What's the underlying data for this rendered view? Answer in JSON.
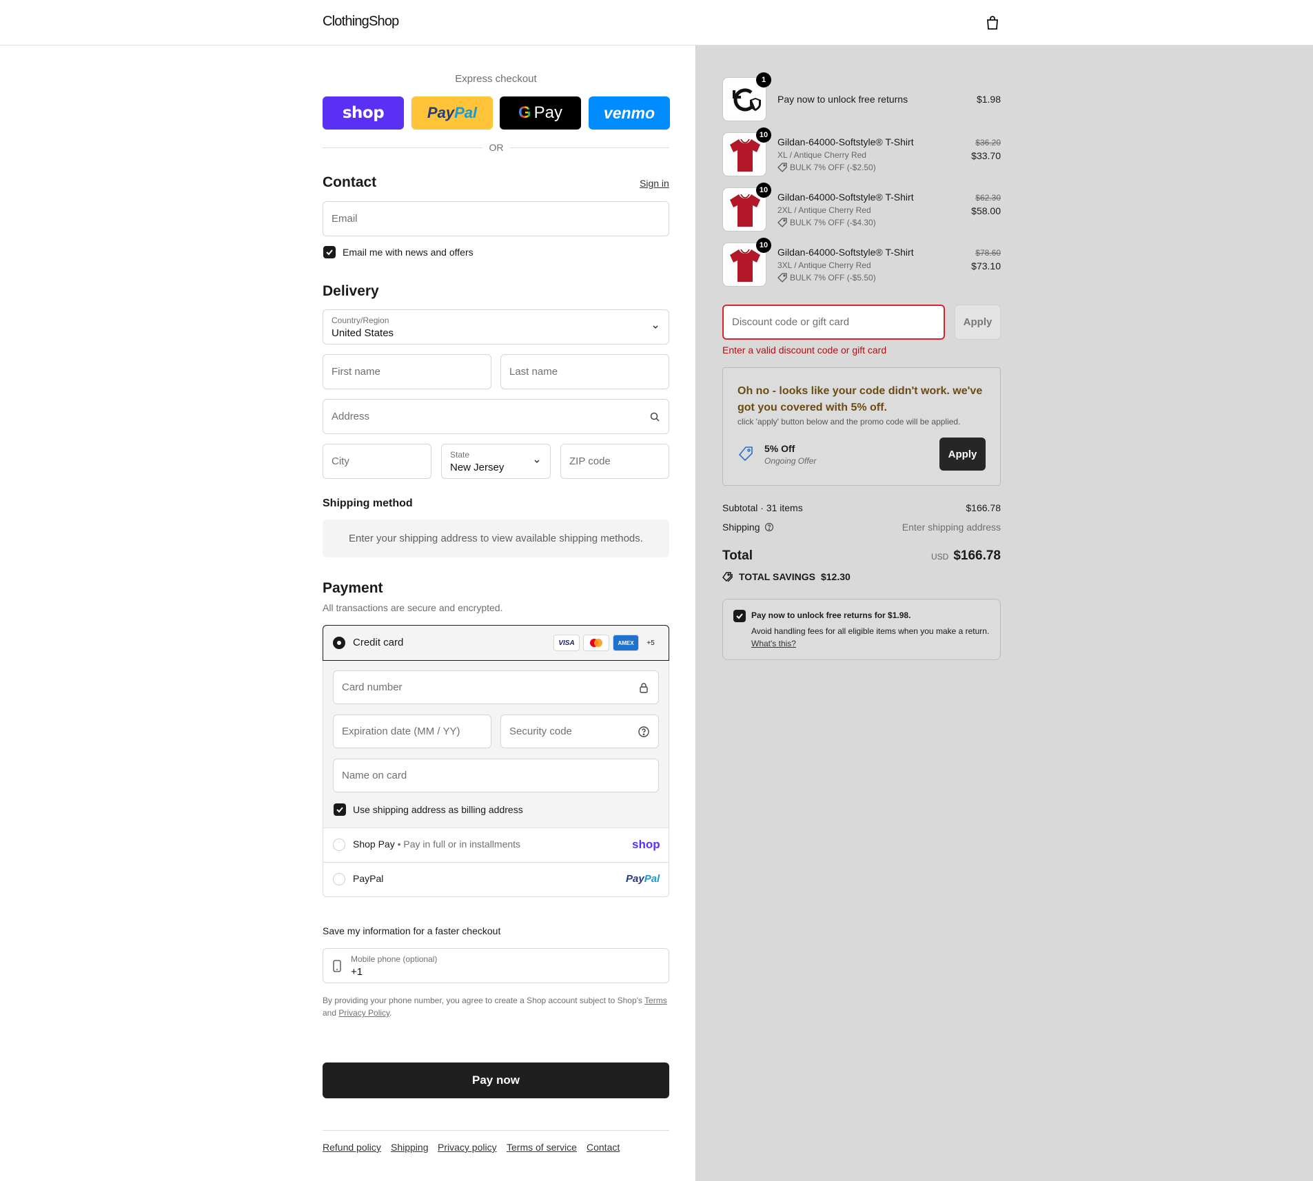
{
  "header": {
    "logo": "ClothingShop",
    "logo_tag": "· · · ·"
  },
  "express": {
    "title": "Express checkout",
    "shop": "shop",
    "paypal_a": "Pay",
    "paypal_b": "Pal",
    "gpay": "Pay",
    "venmo": "venmo",
    "or": "OR"
  },
  "contact": {
    "title": "Contact",
    "sign_in": "Sign in",
    "email_placeholder": "Email",
    "news_label": "Email me with news and offers"
  },
  "delivery": {
    "title": "Delivery",
    "country_label": "Country/Region",
    "country_value": "United States",
    "first_name": "First name",
    "last_name": "Last name",
    "address": "Address",
    "city": "City",
    "state_label": "State",
    "state_value": "New Jersey",
    "zip": "ZIP code"
  },
  "shipping": {
    "title": "Shipping method",
    "message": "Enter your shipping address to view available shipping methods."
  },
  "payment": {
    "title": "Payment",
    "subtitle": "All transactions are secure and encrypted.",
    "credit_card": "Credit card",
    "cards": [
      "VISA",
      "MC",
      "AMEX",
      "+5"
    ],
    "card_number": "Card number",
    "expiry": "Expiration date (MM / YY)",
    "security": "Security code",
    "name_on_card": "Name on card",
    "billing_same": "Use shipping address as billing address",
    "shop_pay": "Shop Pay",
    "shop_pay_sub": "Pay in full or in installments",
    "shop_pay_logo": "shop",
    "paypal": "PayPal",
    "paypal_logo_a": "Pay",
    "paypal_logo_b": "Pal"
  },
  "save_info": {
    "title": "Save my information for a faster checkout",
    "phone_label": "Mobile phone (optional)",
    "phone_value": "+1",
    "legal_1": "By providing your phone number, you agree to create a Shop account subject to Shop's",
    "terms": "Terms",
    "legal_and": "and",
    "privacy": "Privacy Policy",
    "legal_end": "."
  },
  "pay_now": "Pay now",
  "footer": [
    "Refund policy",
    "Shipping",
    "Privacy policy",
    "Terms of service",
    "Contact"
  ],
  "order": {
    "returns_item": {
      "qty": "1",
      "title": "Pay now to unlock free returns",
      "price": "$1.98"
    },
    "items": [
      {
        "qty": "10",
        "title": "Gildan-64000-Softstyle® T-Shirt",
        "variant": "XL / Antique Cherry Red",
        "discount": "BULK 7% OFF (-$2.50)",
        "old_price": "$36.20",
        "price": "$33.70"
      },
      {
        "qty": "10",
        "title": "Gildan-64000-Softstyle® T-Shirt",
        "variant": "2XL / Antique Cherry Red",
        "discount": "BULK 7% OFF (-$4.30)",
        "old_price": "$62.30",
        "price": "$58.00"
      },
      {
        "qty": "10",
        "title": "Gildan-64000-Softstyle® T-Shirt",
        "variant": "3XL / Antique Cherry Red",
        "discount": "BULK 7% OFF (-$5.50)",
        "old_price": "$78.60",
        "price": "$73.10"
      }
    ],
    "discount_placeholder": "Discount code or gift card",
    "discount_apply": "Apply",
    "discount_error": "Enter a valid discount code or gift card",
    "promo": {
      "title": "Oh no - looks like your code didn't work. we've got you covered with 5% off.",
      "subtitle": "click 'apply' button below and the promo code will be applied.",
      "offer": "5% Off",
      "offer_sub": "Ongoing Offer",
      "apply": "Apply"
    },
    "subtotal_label": "Subtotal · 31 items",
    "subtotal_value": "$166.78",
    "shipping_label": "Shipping",
    "shipping_value": "Enter shipping address",
    "total_label": "Total",
    "currency": "USD",
    "total_value": "$166.78",
    "savings_label": "TOTAL SAVINGS",
    "savings_value": "$12.30",
    "returns_box": {
      "title": "Pay now to unlock free returns for $1.98.",
      "desc": "Avoid handling fees for all eligible items when you make a return.",
      "link": "What's this?"
    }
  },
  "colors": {
    "accent_error": "#d9232b",
    "promo_title": "#6b4b12",
    "shop_purple": "#5a31f4",
    "paypal_yellow": "#ffc439",
    "venmo_blue": "#008cff"
  }
}
